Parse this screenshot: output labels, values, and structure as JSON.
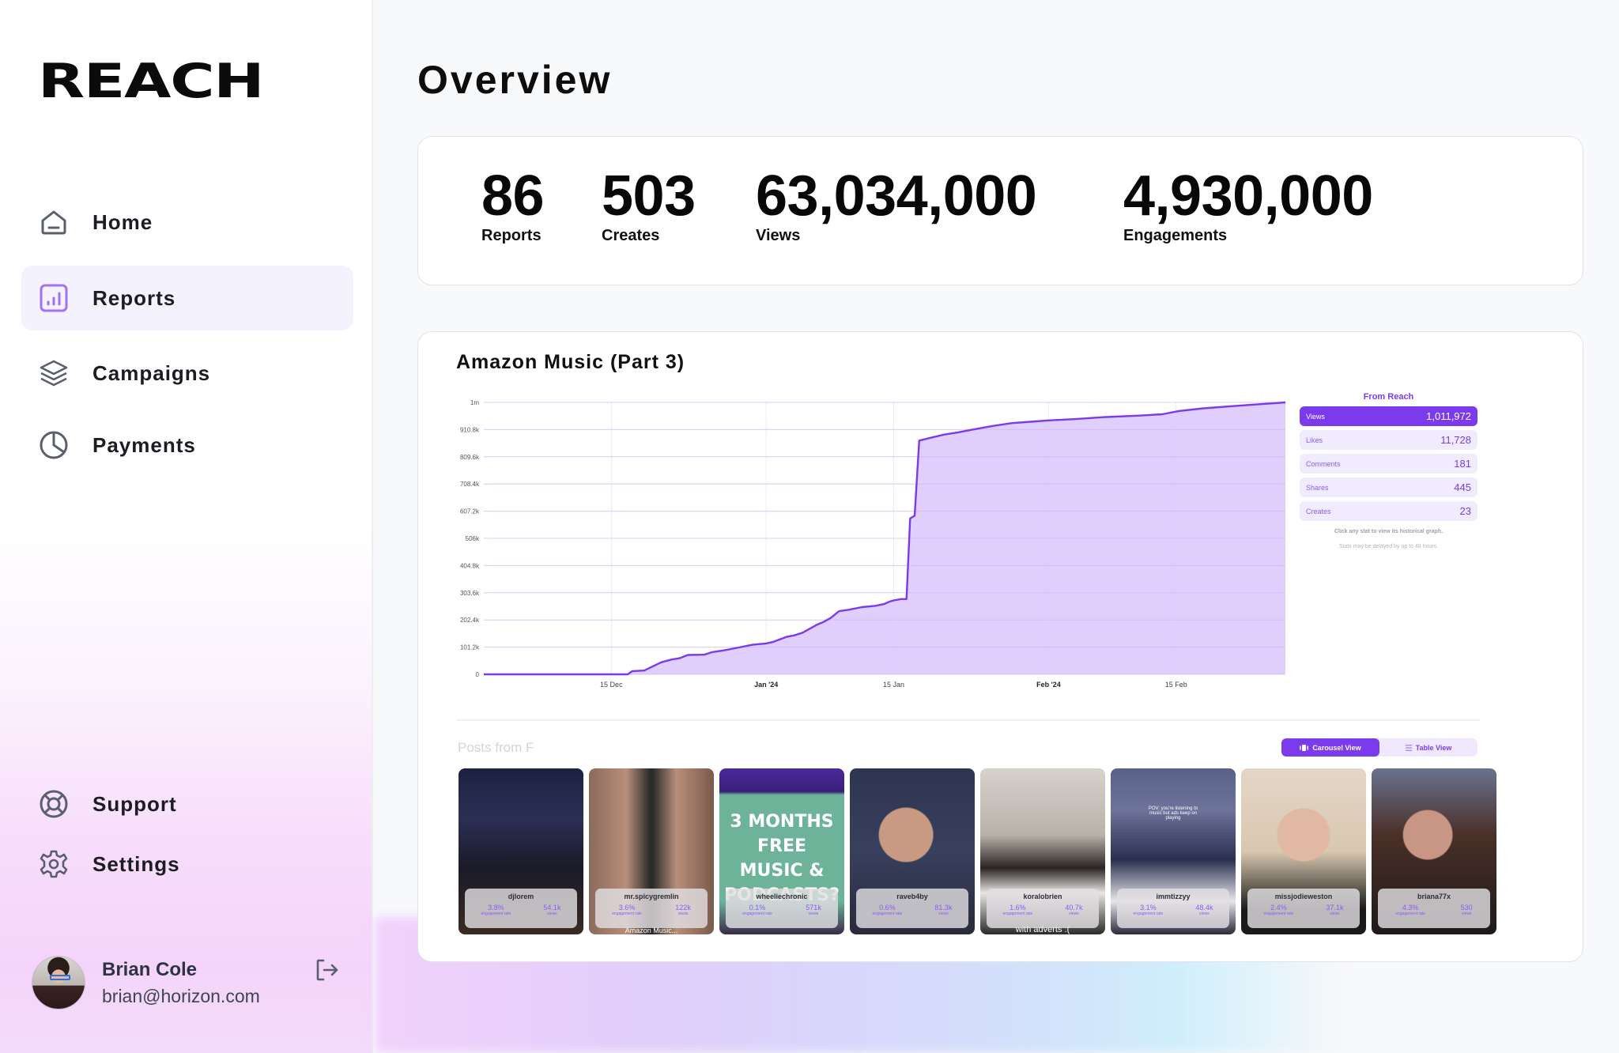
{
  "app": {
    "logo": "REACH"
  },
  "sidebar": {
    "nav": [
      {
        "label": "Home",
        "icon": "home-icon",
        "active": false
      },
      {
        "label": "Reports",
        "icon": "bar-chart-icon",
        "active": true
      },
      {
        "label": "Campaigns",
        "icon": "layers-icon",
        "active": false
      },
      {
        "label": "Payments",
        "icon": "pie-chart-icon",
        "active": false
      }
    ],
    "bottom": [
      {
        "label": "Support",
        "icon": "lifebuoy-icon"
      },
      {
        "label": "Settings",
        "icon": "gear-icon"
      }
    ],
    "user": {
      "name": "Brian Cole",
      "email": "brian@horizon.com"
    }
  },
  "page": {
    "title": "Overview"
  },
  "summary": [
    {
      "value": "86",
      "label": "Reports"
    },
    {
      "value": "503",
      "label": "Creates"
    },
    {
      "value": "63,034,000",
      "label": "Views"
    },
    {
      "value": "4,930,000",
      "label": "Engagements"
    }
  ],
  "report": {
    "title": "Amazon Music (Part 3)",
    "panel": {
      "title": "From Reach",
      "rows": [
        {
          "label": "Views",
          "value": "1,011,972",
          "active": true
        },
        {
          "label": "Likes",
          "value": "11,728",
          "active": false
        },
        {
          "label": "Comments",
          "value": "181",
          "active": false
        },
        {
          "label": "Shares",
          "value": "445",
          "active": false
        },
        {
          "label": "Creates",
          "value": "23",
          "active": false
        }
      ],
      "note1": "Click any stat to view its historical graph.",
      "note2": "Stats may be delayed by up to 48 hours."
    },
    "posts_title": "Posts from F",
    "view_toggle": {
      "carousel": "Carousel View",
      "table": "Table View",
      "active": "carousel"
    },
    "posts": [
      {
        "handle": "djlorem",
        "engagement": "3.8%",
        "views": "54.1k",
        "caption": ""
      },
      {
        "handle": "mr.spicygremlin",
        "engagement": "3.6%",
        "views": "122k",
        "caption": "Amazon Music..."
      },
      {
        "handle": "wheeliechronic",
        "engagement": "0.1%",
        "views": "571k",
        "caption": "3 MONTHS FREE MUSIC & PODCASTS?"
      },
      {
        "handle": "raveb4by",
        "engagement": "0.6%",
        "views": "81.3k",
        "caption": ""
      },
      {
        "handle": "koralobrien",
        "engagement": "1.6%",
        "views": "40.7k",
        "caption": "with adverts :("
      },
      {
        "handle": "immtizzyy",
        "engagement": "3.1%",
        "views": "48.4k",
        "caption": "POV: you're listening to music but ads keep on playing"
      },
      {
        "handle": "missjodieweston",
        "engagement": "2.4%",
        "views": "37.1k",
        "caption": ""
      },
      {
        "handle": "briana77x",
        "engagement": "4.3%",
        "views": "530",
        "caption": ""
      }
    ],
    "metric_labels": {
      "engagement": "engagement rate",
      "views": "views"
    }
  },
  "chart_data": {
    "type": "area",
    "title": "Amazon Music (Part 3)",
    "series_name": "Views",
    "xlabel": "",
    "ylabel": "",
    "ylim": [
      0,
      1012000
    ],
    "y_ticks": [
      "0",
      "101.2k",
      "202.4k",
      "303.6k",
      "404.8k",
      "506k",
      "607.2k",
      "708.4k",
      "809.6k",
      "910.8k",
      "1m"
    ],
    "y_tick_values": [
      0,
      101200,
      202400,
      303600,
      404800,
      506000,
      607200,
      708400,
      809600,
      910800,
      1012000
    ],
    "x_ticks": [
      {
        "label": "15 Dec",
        "day": 14,
        "bold": false
      },
      {
        "label": "Jan '24",
        "day": 31,
        "bold": true
      },
      {
        "label": "15 Jan",
        "day": 45,
        "bold": false
      },
      {
        "label": "Feb '24",
        "day": 62,
        "bold": true
      },
      {
        "label": "15 Feb",
        "day": 76,
        "bold": false
      }
    ],
    "x_range_days": [
      0,
      88
    ],
    "grid": true,
    "points": [
      [
        0,
        0
      ],
      [
        14,
        0
      ],
      [
        15.8,
        0
      ],
      [
        16.3,
        12000
      ],
      [
        17.6,
        14000
      ],
      [
        19.5,
        45000
      ],
      [
        20.6,
        55000
      ],
      [
        21.5,
        60000
      ],
      [
        22.4,
        72000
      ],
      [
        24.2,
        73000
      ],
      [
        25,
        82000
      ],
      [
        26.5,
        90000
      ],
      [
        28,
        100000
      ],
      [
        29.5,
        110000
      ],
      [
        31,
        115000
      ],
      [
        31.7,
        120000
      ],
      [
        32.5,
        130000
      ],
      [
        33.3,
        140000
      ],
      [
        34.1,
        145000
      ],
      [
        35,
        155000
      ],
      [
        35.8,
        170000
      ],
      [
        36.6,
        185000
      ],
      [
        37.3,
        195000
      ],
      [
        38.1,
        210000
      ],
      [
        39,
        235000
      ],
      [
        40,
        240000
      ],
      [
        41.5,
        250000
      ],
      [
        43,
        255000
      ],
      [
        44,
        262000
      ],
      [
        44.5,
        270000
      ],
      [
        45,
        275000
      ],
      [
        45.8,
        280000
      ],
      [
        46.4,
        280000
      ],
      [
        46.8,
        580000
      ],
      [
        47.3,
        590000
      ],
      [
        47.8,
        870000
      ],
      [
        49,
        880000
      ],
      [
        50.5,
        892000
      ],
      [
        52,
        900000
      ],
      [
        54,
        913000
      ],
      [
        56,
        925000
      ],
      [
        58,
        935000
      ],
      [
        60,
        940000
      ],
      [
        62,
        945000
      ],
      [
        65,
        950000
      ],
      [
        68,
        957000
      ],
      [
        72,
        963000
      ],
      [
        74.5,
        968000
      ],
      [
        76.3,
        980000
      ],
      [
        79,
        990000
      ],
      [
        83,
        1000000
      ],
      [
        88,
        1011972
      ]
    ]
  }
}
